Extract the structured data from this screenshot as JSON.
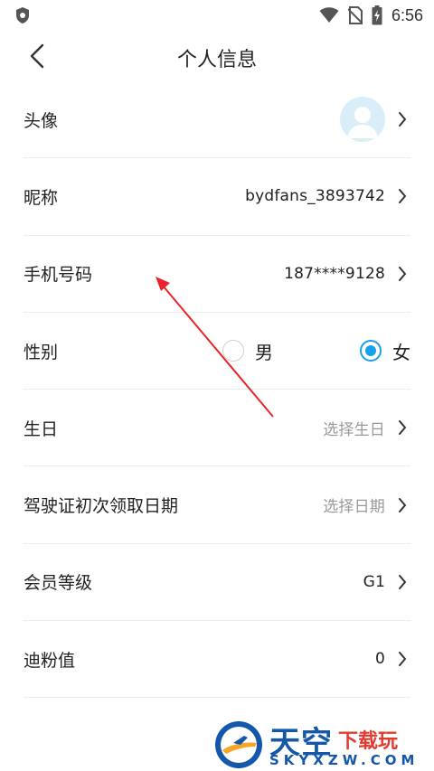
{
  "statusbar": {
    "time": "6:56"
  },
  "header": {
    "title": "个人信息"
  },
  "rows": {
    "avatar": {
      "label": "头像"
    },
    "nickname": {
      "label": "昵称",
      "value": "bydfans_3893742"
    },
    "phone": {
      "label": "手机号码",
      "value": "187****9128"
    },
    "gender": {
      "label": "性别",
      "male": "男",
      "female": "女",
      "selected": "女"
    },
    "birthday": {
      "label": "生日",
      "value": "选择生日"
    },
    "license": {
      "label": "驾驶证初次领取日期",
      "value": "选择日期"
    },
    "member": {
      "label": "会员等级",
      "value": "G1"
    },
    "points": {
      "label": "迪粉值",
      "value": "0"
    }
  },
  "watermark": {
    "brand": "天空",
    "sub": "下载玩",
    "site": "SKYXZW.COM"
  },
  "colors": {
    "accent": "#1aa0e8",
    "arrow": "#e8232a"
  }
}
